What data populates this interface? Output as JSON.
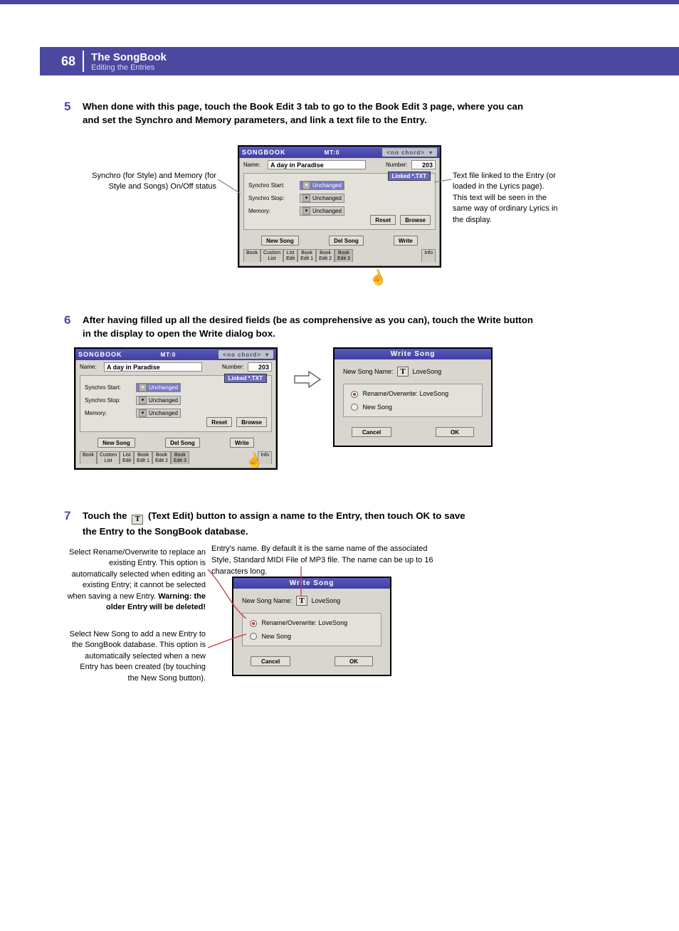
{
  "header": {
    "page_number": "68",
    "title": "The SongBook",
    "subtitle": "Editing the Entries"
  },
  "steps": {
    "s5": {
      "num": "5",
      "text": "When done with this page, touch the Book Edit 3 tab to go to the Book Edit 3 page, where you can and set the Synchro and Memory parameters, and link a text file to the Entry."
    },
    "s6": {
      "num": "6",
      "text": "After having filled up all the desired fields (be as comprehensive as you can), touch the Write button in the display to open the Write dialog box."
    },
    "s7": {
      "num": "7",
      "text_pre": "Touch the ",
      "text_post": " (Text Edit) button to assign a name to the Entry, then touch OK to save the Entry to the SongBook database."
    }
  },
  "callouts": {
    "synchro_memory": "Synchro (for Style) and Memory (for Style and Songs) On/Off status",
    "text_linked": "Text file linked to the Entry (or loaded in the Lyrics page). This text will be seen in the same way of ordinary Lyrics in the display.",
    "rename": "Select Rename/Overwrite to replace an existing Entry. This option is automatically selected when editing an existing Entry; it cannot be selected when saving a new Entry. ",
    "rename_warn": "Warning: the older Entry will be deleted!",
    "newsong": "Select New Song to add a new Entry to the SongBook database. This option is automatically selected when a new Entry has been created (by touching the New Song button).",
    "entryname": "Entry's name. By default it is the same name of the associated Style, Standard MIDI File of MP3 file. The name can be up to 16 characters long."
  },
  "panel_common": {
    "titlebar": "SONGBOOK",
    "mt": "MT:0",
    "chord": "<no chord>",
    "name_label": "Name:",
    "name_value": "A day in Paradise",
    "number_label": "Number:",
    "number_value": "203",
    "linked_txt": "Linked *.TXT",
    "synchro_start": "Synchro Start:",
    "synchro_stop": "Synchro Stop:",
    "memory": "Memory:",
    "unchanged": "Unchanged",
    "reset": "Reset",
    "browse": "Browse",
    "new_song": "New Song",
    "del_song": "Del Song",
    "write": "Write",
    "tabs": {
      "book": "Book",
      "custom": "Custom\nList",
      "listedit": "List\nEdit",
      "be1": "Book\nEdit 1",
      "be2": "Book\nEdit 2",
      "be3": "Book\nEdit 3",
      "info": "Info"
    }
  },
  "write_dialog": {
    "title": "Write Song",
    "new_name_label": "New Song Name:",
    "new_name_value": "LoveSong",
    "rename_label": "Rename/Overwrite: LoveSong",
    "new_song_label": "New Song",
    "cancel": "Cancel",
    "ok": "OK",
    "t": "T"
  }
}
